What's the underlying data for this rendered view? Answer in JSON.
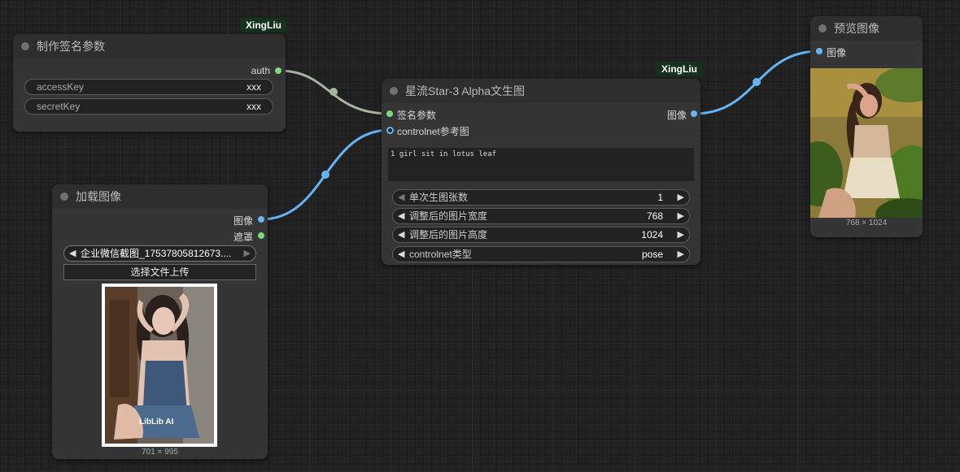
{
  "links": [
    {
      "from": "制作签名参数.auth",
      "to": "星流Star-3 Alpha文生图.签名参数",
      "color": "#a7b59f"
    },
    {
      "from": "加载图像.图像",
      "to": "星流Star-3 Alpha文生图.controlnet参考图",
      "color": "#64b5f6"
    },
    {
      "from": "星流Star-3 Alpha文生图.图像",
      "to": "预览图像.图像",
      "color": "#64b5f6"
    }
  ],
  "sign_node": {
    "badge": "XingLiu",
    "title": "制作签名参数",
    "output_auth": "auth",
    "widgets": [
      {
        "label": "accessKey",
        "value": "xxx"
      },
      {
        "label": "secretKey",
        "value": "xxx"
      }
    ]
  },
  "load_node": {
    "title": "加载图像",
    "output_image": "图像",
    "output_mask": "遮罩",
    "file_combo": "企业微信截图_17537805812673....",
    "upload_label": "选择文件上传",
    "watermark": "LibLib AI",
    "dims": "701 × 995"
  },
  "star_node": {
    "badge": "XingLiu",
    "title": "星流Star-3 Alpha文生图",
    "input_sign": "签名参数",
    "input_controlnet": "controlnet参考图",
    "output_image": "图像",
    "prompt": "1 girl sit in lotus leaf",
    "widgets": [
      {
        "label": "单次生图张数",
        "value": "1"
      },
      {
        "label": "调整后的图片宽度",
        "value": "768"
      },
      {
        "label": "调整后的图片高度",
        "value": "1024"
      },
      {
        "label": "controlnet类型",
        "value": "pose"
      }
    ]
  },
  "preview_node": {
    "title": "预览图像",
    "input_image": "图像",
    "dims": "768 × 1024"
  },
  "colors": {
    "link_gray": "#a7b59f",
    "link_blue": "#64b5f6",
    "slot_green": "#7ed97e",
    "badge_bg": "#14321e"
  }
}
